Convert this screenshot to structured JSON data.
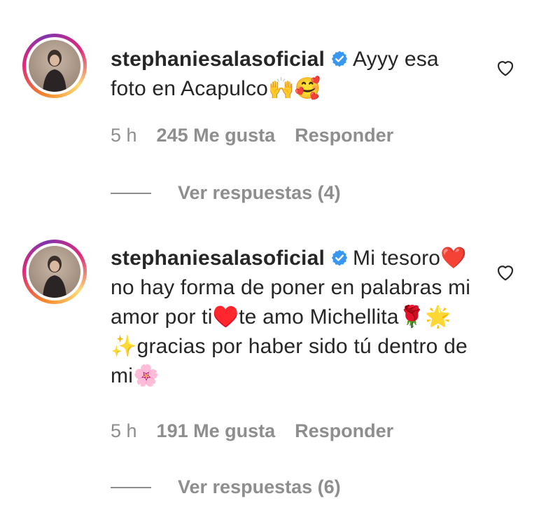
{
  "comments": [
    {
      "username": "stephaniesalasoficial",
      "text": "Ayyy esa foto en Acapulco🙌🥰",
      "time": "5 h",
      "likes": "245 Me gusta",
      "reply_label": "Responder",
      "replies_label": "Ver respuestas (4)"
    },
    {
      "username": "stephaniesalasoficial",
      "text": "Mi tesoro❤️no hay forma de poner en palabras mi amor por ti♥️te amo Michellita🌹🌟✨gracias por haber sido tú dentro de mi🌸",
      "time": "5 h",
      "likes": "191 Me gusta",
      "reply_label": "Responder",
      "replies_label": "Ver respuestas (6)"
    }
  ],
  "icons": {
    "verified": "verified-badge-icon",
    "like": "heart-outline-icon"
  },
  "colors": {
    "verified_blue": "#3897f0",
    "meta_gray": "#8e8e8e",
    "text": "#262626"
  }
}
